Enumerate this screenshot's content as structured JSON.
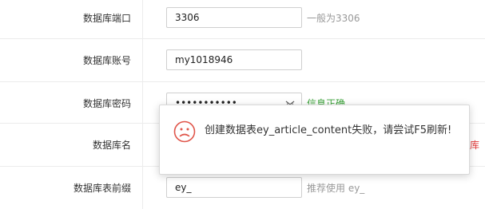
{
  "form": {
    "port": {
      "label": "数据库端口",
      "value": "3306",
      "hint": "一般为3306"
    },
    "account": {
      "label": "数据库账号",
      "value": "my1018946"
    },
    "password": {
      "label": "数据库密码",
      "value": "•••••••••••",
      "hint": "信息正确",
      "eye_icon": "eye-icon"
    },
    "dbname": {
      "label": "数据库名",
      "hint": "库"
    },
    "prefix": {
      "label": "数据库表前缀",
      "value": "ey_",
      "hint": "推荐使用 ey_"
    }
  },
  "toast": {
    "icon": "sad-face-icon",
    "message": "创建数据表ey_article_content失败，请尝试F5刷新!"
  },
  "colors": {
    "success": "#3aa238",
    "error": "#e23a3a",
    "toast_icon": "#e0554a",
    "hint": "#999999"
  }
}
